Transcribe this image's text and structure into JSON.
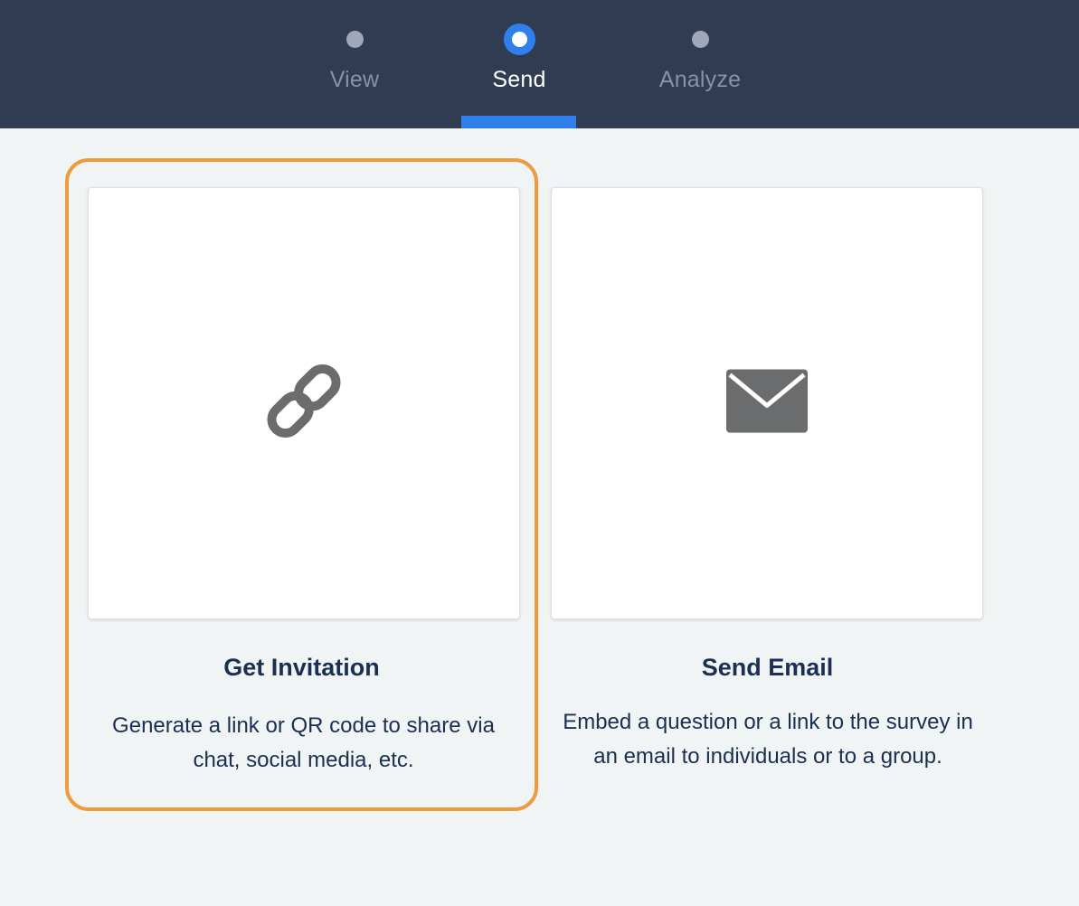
{
  "steps": [
    {
      "label": "View",
      "active": false
    },
    {
      "label": "Send",
      "active": true
    },
    {
      "label": "Analyze",
      "active": false
    }
  ],
  "options": [
    {
      "title": "Get Invitation",
      "description": "Generate a link or QR code to share via chat, social media, etc.",
      "icon": "link-icon",
      "selected": true
    },
    {
      "title": "Send Email",
      "description": "Embed a question or a link to the survey in an email to individuals or to a group.",
      "icon": "envelope-icon",
      "selected": false
    }
  ],
  "colors": {
    "topbar_bg": "#2f3c52",
    "accent_blue": "#2f80ea",
    "selection_orange": "#ee9a3f",
    "page_bg": "#f1f4f4",
    "icon_gray": "#6b6c6e",
    "text_navy": "#1b2f52"
  }
}
